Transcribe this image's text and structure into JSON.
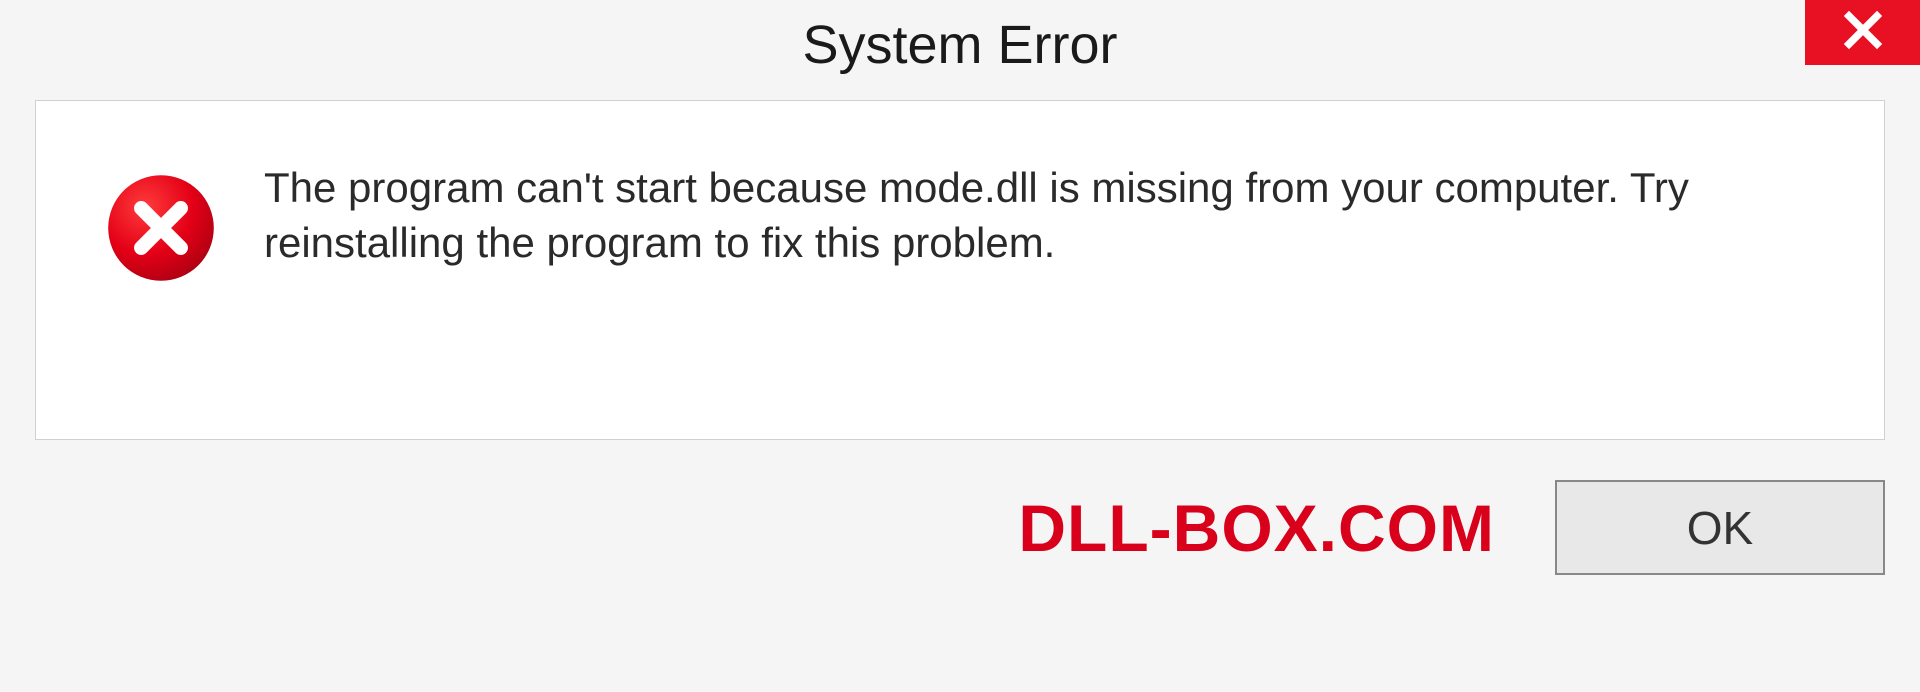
{
  "window": {
    "title": "System Error"
  },
  "error": {
    "message": "The program can't start because mode.dll is missing from your computer. Try reinstalling the program to fix this problem."
  },
  "watermark": "DLL-BOX.COM",
  "buttons": {
    "ok": "OK"
  },
  "icons": {
    "close": "close-x",
    "error": "error-circle-x"
  },
  "colors": {
    "close_bg": "#e81123",
    "error_fill": "#d9001b",
    "watermark": "#d9001b"
  }
}
